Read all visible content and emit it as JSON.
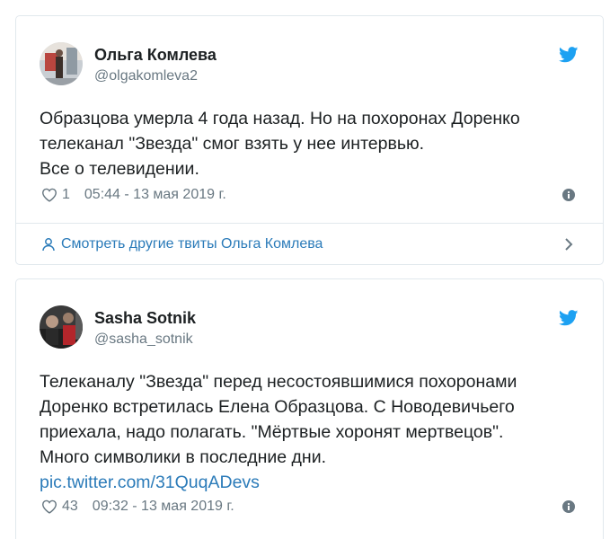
{
  "tweets": [
    {
      "author": {
        "name": "Ольга Комлева",
        "handle": "@olgakomleva2",
        "avatar": "user-photo"
      },
      "text_lines": [
        "Образцова умерла 4 года назад. Но на похоронах Доренко",
        "телеканал \"Звезда\" смог взять у нее интервью.",
        "Все о телевидении."
      ],
      "likes": "1",
      "timestamp": "05:44 - 13 мая 2019 г.",
      "more_tweets_label": "Смотреть другие твиты Ольга Комлева"
    },
    {
      "author": {
        "name": "Sasha Sotnik",
        "handle": "@sasha_sotnik",
        "avatar": "user-photo"
      },
      "text_lines": [
        "Телеканалу \"Звезда\" перед несостоявшимися похоронами",
        "Доренко встретилась Елена Образцова. С Новодевичьего",
        "приехала, надо полагать. \"Мёртвые хоронят мертвецов\".",
        "Много символики в последние дни."
      ],
      "link": "pic.twitter.com/31QuqADevs",
      "likes": "43",
      "timestamp": "09:32 - 13 мая 2019 г."
    }
  ],
  "icons": {
    "brand": "twitter-bird-icon",
    "like": "heart-icon",
    "info": "info-icon",
    "profile": "person-icon",
    "next": "chevron-right-icon"
  },
  "colors": {
    "twitter_blue": "#1da1f2",
    "link": "#2b7bb9",
    "text": "#1c2022",
    "muted": "#697882",
    "border": "#e1e8ed"
  }
}
